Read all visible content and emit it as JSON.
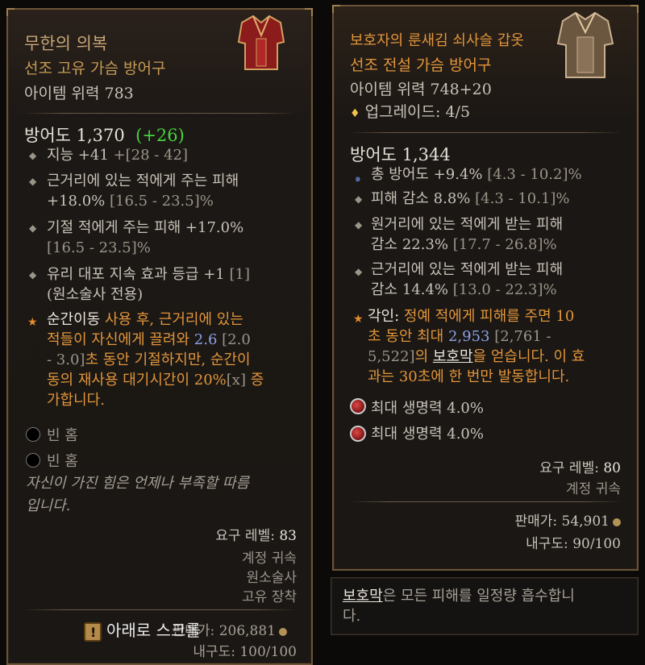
{
  "left": {
    "title": "무한의 의복",
    "type": "선조 고유 가슴 방어구",
    "power": "아이템 위력 783",
    "armor": "방어도 1,370",
    "armor_delta": "(+26)",
    "affixes": [
      {
        "text": "지능 +41 ",
        "range": "+[28 - 42]"
      },
      {
        "text": "근거리에 있는 적에게 주는 피해",
        "text2": "+18.0% ",
        "range": "[16.5 - 23.5]%"
      },
      {
        "text": "기절 적에게 주는 피해 +17.0%",
        "range": "[16.5 - 23.5]%"
      },
      {
        "text": "유리 대포 지속 효과 등급 +1 ",
        "range": "[1]",
        "text2": "(원소술사 전용)"
      }
    ],
    "unique_power": {
      "p1": "순간이동",
      "p2": " 사용 후, 근거리에 있는",
      "p3": "적들이 자신에게 끌려와 ",
      "p4": "2.6",
      "p5": " [2.0",
      "p6": "- 3.0]",
      "p7": "초 동안 기절하지만, 순간이",
      "p8": "동의 재사용 대기시간이 20%",
      "p9": "[x]",
      "p10": " 증",
      "p11": "가합니다."
    },
    "sockets": [
      "빈 홈",
      "빈 홈"
    ],
    "flavor1": "자신이 가진 힘은 언제나 부족할 따름",
    "flavor2": "입니다.",
    "req_level_label": "요구 레벨: ",
    "req_level": "83",
    "bound": "계정 귀속",
    "class": "원소술사",
    "slot": "고유 장착",
    "sell": "판매가: 206,881",
    "durability": "내구도: 100/100",
    "scroll_label": "아래로 스크롤"
  },
  "right": {
    "title": "보호자의 룬새김 쇠사슬 갑옷",
    "type": "선조 전설 가슴 방어구",
    "power": "아이템 위력 748+20",
    "upgrade": "업그레이드: 4/5",
    "armor": "방어도 1,344",
    "affixes": [
      {
        "text": "총 방어도 +9.4% ",
        "range": "[4.3 - 10.2]%"
      },
      {
        "text": "피해 감소 8.8% ",
        "range": "[4.3 - 10.1]%"
      },
      {
        "text": "원거리에 있는 적에게 받는 피해",
        "text2": "감소 22.3% ",
        "range": "[17.7 - 26.8]%"
      },
      {
        "text": "근거리에 있는 적에게 받는 피해",
        "text2": "감소 14.4% ",
        "range": "[13.0 - 22.3]%"
      }
    ],
    "aspect": {
      "a1": "각인: ",
      "a2": "정예 적에게 피해를 주면 10",
      "a3": "초 동안 최대 ",
      "a4": "2,953",
      "a5": " [2,761 -",
      "a6": "5,522]",
      "a7": "의 ",
      "a8": "보호막",
      "a9": "을 얻습니다. 이 효",
      "a10": "과는 30초에 한 번만 발동합니다."
    },
    "gems": [
      "최대 생명력 4.0%",
      "최대 생명력 4.0%"
    ],
    "req_level_label": "요구 레벨: ",
    "req_level": "80",
    "bound": "계정 귀속",
    "sell": "판매가: 54,901",
    "durability": "내구도: 90/100"
  },
  "tooltip": {
    "keyword": "보호막",
    "text1": "은 모든 피해를 일정량 흡수합니",
    "text2": "다."
  },
  "colors": {
    "orange": "#e2953a",
    "gold": "#c79b54",
    "green": "#47d23c",
    "blue": "#8da1e8"
  }
}
